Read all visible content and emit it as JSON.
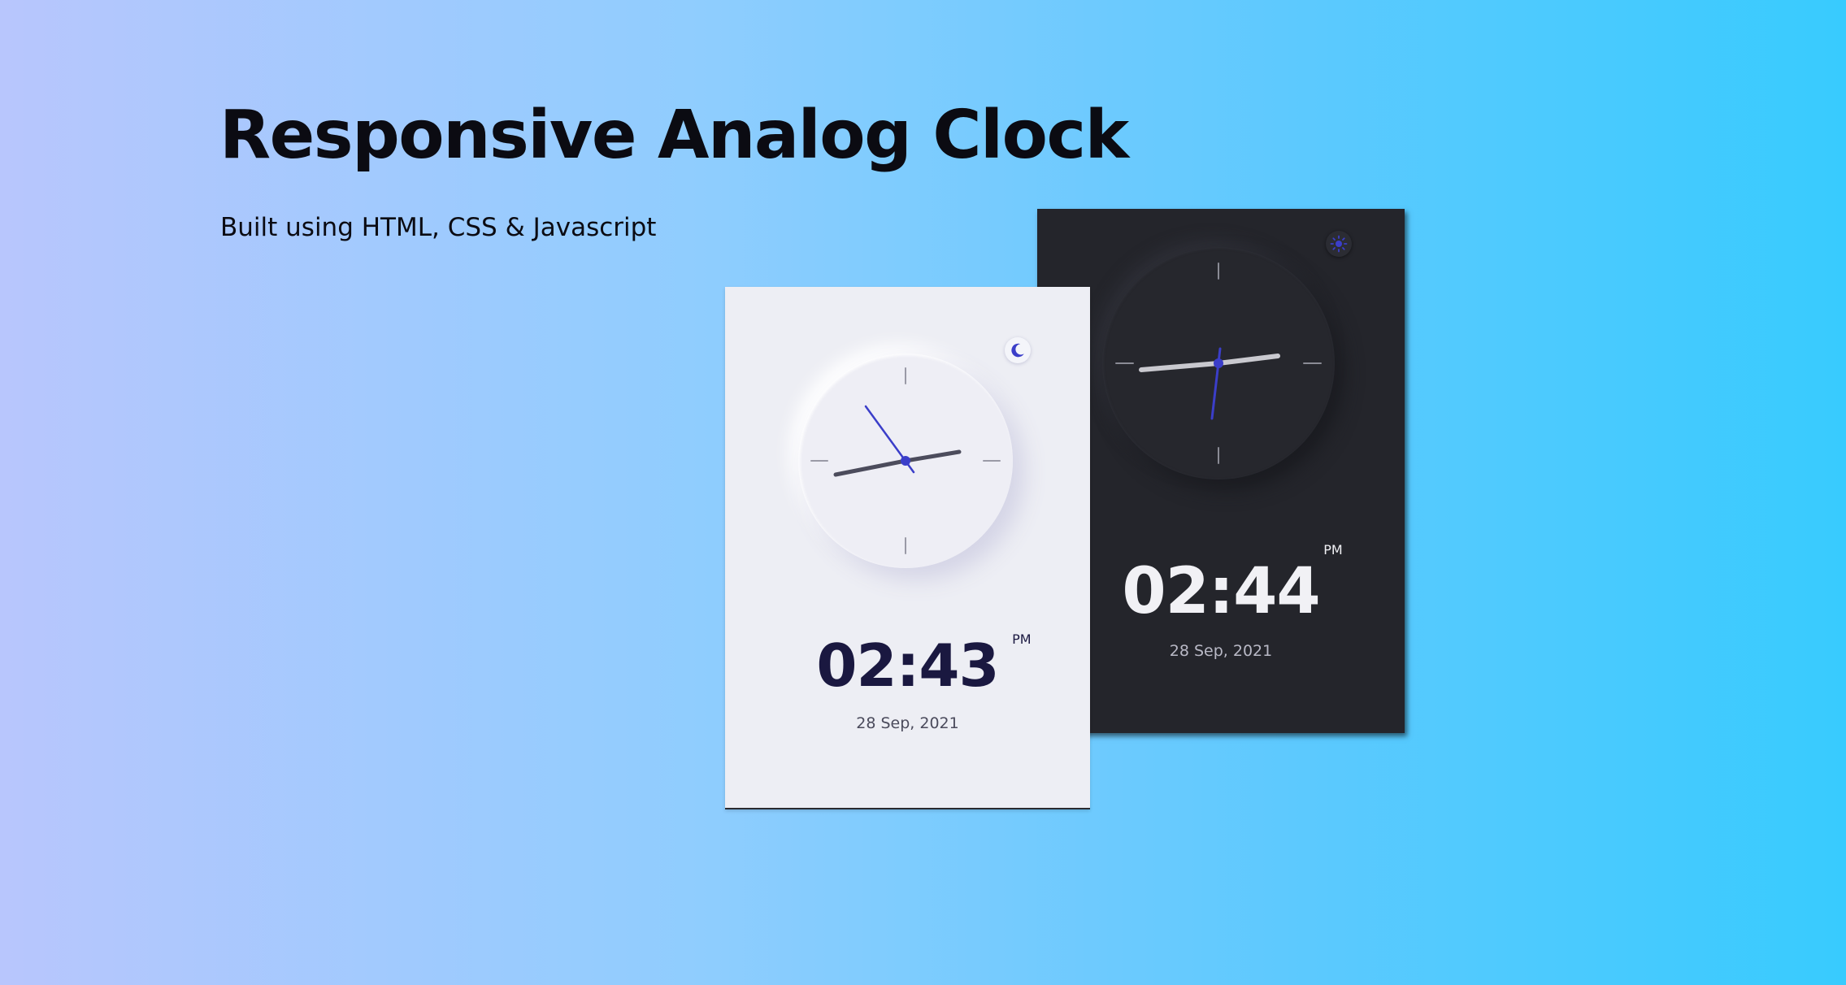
{
  "header": {
    "title": "Responsive Analog Clock",
    "subtitle": "Built using HTML, CSS & Javascript"
  },
  "light_clock": {
    "theme": "light",
    "toggle_icon": "moon-icon",
    "time": "02:43",
    "period": "PM",
    "date": "28 Sep, 2021",
    "colors": {
      "background": "#edeef4",
      "accent": "#3b3ec9",
      "text": "#1a1840"
    }
  },
  "dark_clock": {
    "theme": "dark",
    "toggle_icon": "sun-icon",
    "time": "02:44",
    "period": "PM",
    "date": "28 Sep, 2021",
    "colors": {
      "background": "#24252b",
      "accent": "#3b3ec9",
      "text": "#f1f1f5"
    }
  },
  "colors": {
    "page_gradient_start": "#b8c6fd",
    "page_gradient_end": "#38cbfe"
  }
}
